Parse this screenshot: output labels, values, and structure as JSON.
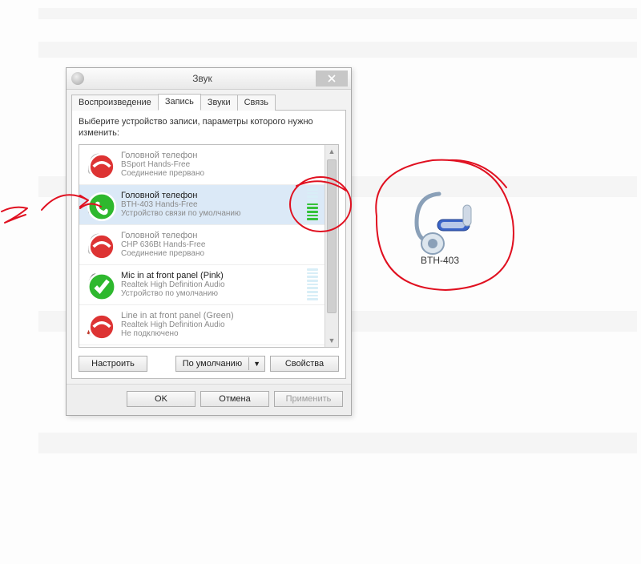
{
  "dialog": {
    "title": "Звук",
    "tabs": [
      "Воспроизведение",
      "Запись",
      "Звуки",
      "Связь"
    ],
    "active_tab_index": 1,
    "instruction": "Выберите устройство записи, параметры которого нужно изменить:",
    "configure_btn": "Настроить",
    "default_btn": "По умолчанию",
    "properties_btn": "Свойства",
    "ok_btn": "OK",
    "cancel_btn": "Отмена",
    "apply_btn": "Применить"
  },
  "devices": [
    {
      "name": "Головной телефон",
      "sub": "BSport Hands-Free",
      "status": "Соединение прервано",
      "icon": "headset",
      "overlay": "disconnected",
      "meter": "none",
      "selected": false
    },
    {
      "name": "Головной телефон",
      "sub": "BTH-403 Hands-Free",
      "status": "Устройство связи по умолчанию",
      "icon": "headset",
      "overlay": "call",
      "meter": "active",
      "selected": true
    },
    {
      "name": "Головной телефон",
      "sub": "CHP 636Bt Hands-Free",
      "status": "Соединение прервано",
      "icon": "headset",
      "overlay": "disconnected",
      "meter": "none",
      "selected": false
    },
    {
      "name": "Mic in at front panel (Pink)",
      "sub": "Realtek High Definition Audio",
      "status": "Устройство по умолчанию",
      "icon": "mic",
      "overlay": "default",
      "meter": "idle",
      "selected": false
    },
    {
      "name": "Line in at front panel (Green)",
      "sub": "Realtek High Definition Audio",
      "status": "Не подключено",
      "icon": "linein",
      "overlay": "disconnected",
      "meter": "none",
      "selected": false
    }
  ],
  "annotation": {
    "bt_device_label": "BTH-403"
  }
}
